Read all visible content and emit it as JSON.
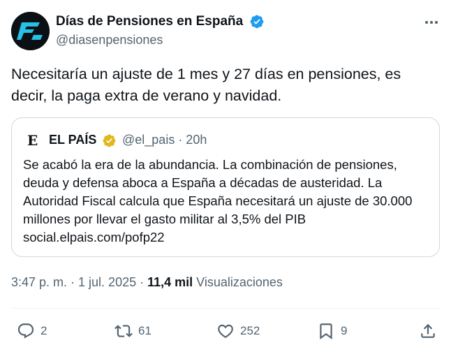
{
  "author": {
    "name": "Días de Pensiones en España",
    "handle": "@diasenpensiones",
    "verified_color": "#1d9bf0"
  },
  "tweet": {
    "text": "Necesitaría un ajuste de 1 mes y 27 días en pensiones, es decir, la paga extra de verano y navidad."
  },
  "quote": {
    "logo_letter": "E",
    "name": "EL PAÍS",
    "verified_color": "#e2b719",
    "handle_time": "@el_pais · 20h",
    "text": "Se acabó la era de la abundancia. La combinación de pensiones, deuda y defensa aboca a España a décadas de austeridad. La Autoridad Fiscal calcula que España necesitará un ajuste de 30.000 millones por llevar el gasto militar al 3,5% del PIB social.elpais.com/pofp22"
  },
  "meta": {
    "time_date": "3:47 p. m. · 1 jul. 2025 · ",
    "views_count": "11,4 mil",
    "views_label": " Visualizaciones"
  },
  "actions": {
    "replies": "2",
    "reposts": "61",
    "likes": "252",
    "bookmarks": "9"
  },
  "icons": [
    "more-icon",
    "verified-badge-icon",
    "reply-icon",
    "repost-icon",
    "like-icon",
    "bookmark-icon",
    "share-icon"
  ],
  "colors": {
    "text": "#0f1419",
    "secondary": "#536471",
    "border": "#cfd9de"
  }
}
